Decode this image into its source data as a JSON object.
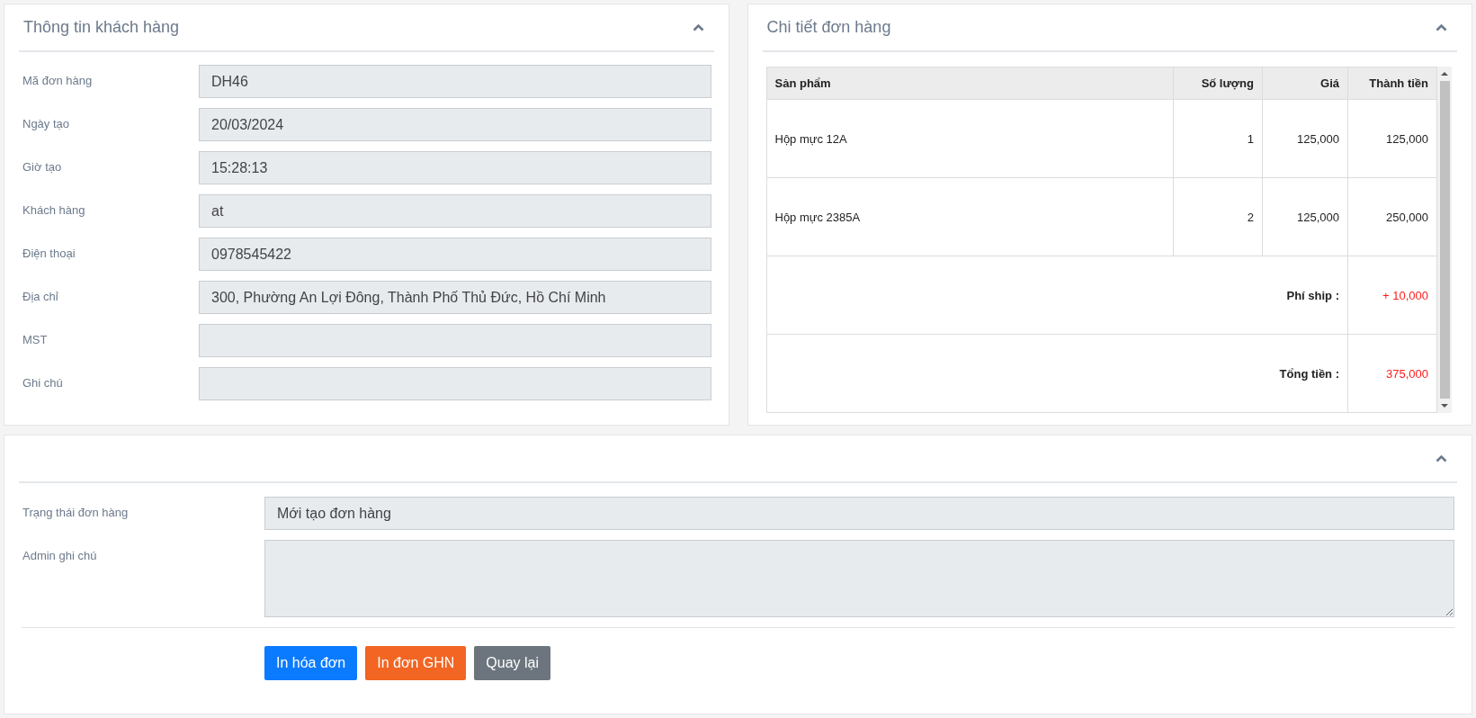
{
  "customer_panel": {
    "title": "Thông tin khách hàng",
    "expanded": true,
    "fields": [
      {
        "label": "Mã đơn hàng",
        "value": "DH46"
      },
      {
        "label": "Ngày tạo",
        "value": "20/03/2024"
      },
      {
        "label": "Giờ tạo",
        "value": "15:28:13"
      },
      {
        "label": "Khách hàng",
        "value": "at"
      },
      {
        "label": "Điện thoại",
        "value": "0978545422"
      },
      {
        "label": "Địa chỉ",
        "value": "300, Phường An Lợi Đông, Thành Phố Thủ Đức, Hồ Chí Minh"
      },
      {
        "label": "MST"
      },
      {
        "label": "Ghi chú"
      }
    ]
  },
  "order_panel": {
    "title": "Chi tiết đơn hàng",
    "expanded": true,
    "table": {
      "columns": [
        "Sản phẩm",
        "Số lượng",
        "Giá",
        "Thành tiền"
      ],
      "rows": [
        [
          "Hộp mực 12A",
          "1",
          "125,000",
          "125,000"
        ],
        [
          "Hộp mực 2385A",
          "2",
          "125,000",
          "250,000"
        ]
      ],
      "summary": [
        {
          "label": "Phí ship :",
          "value": "+ 10,000"
        },
        {
          "label": "Tổng tiền :",
          "value": "375,000"
        }
      ]
    }
  },
  "status_panel": {
    "expanded": true,
    "fields": [
      {
        "kind": "input",
        "label": "Trạng thái đơn hàng",
        "value": "Mới tạo đơn hàng"
      },
      {
        "kind": "textarea",
        "label": "Admin ghi chú"
      }
    ],
    "buttons": [
      {
        "label": "In hóa đơn",
        "kind": "primary"
      },
      {
        "label": "In đơn GHN",
        "kind": "warning"
      },
      {
        "label": "Quay lại",
        "kind": "secondary"
      }
    ]
  }
}
